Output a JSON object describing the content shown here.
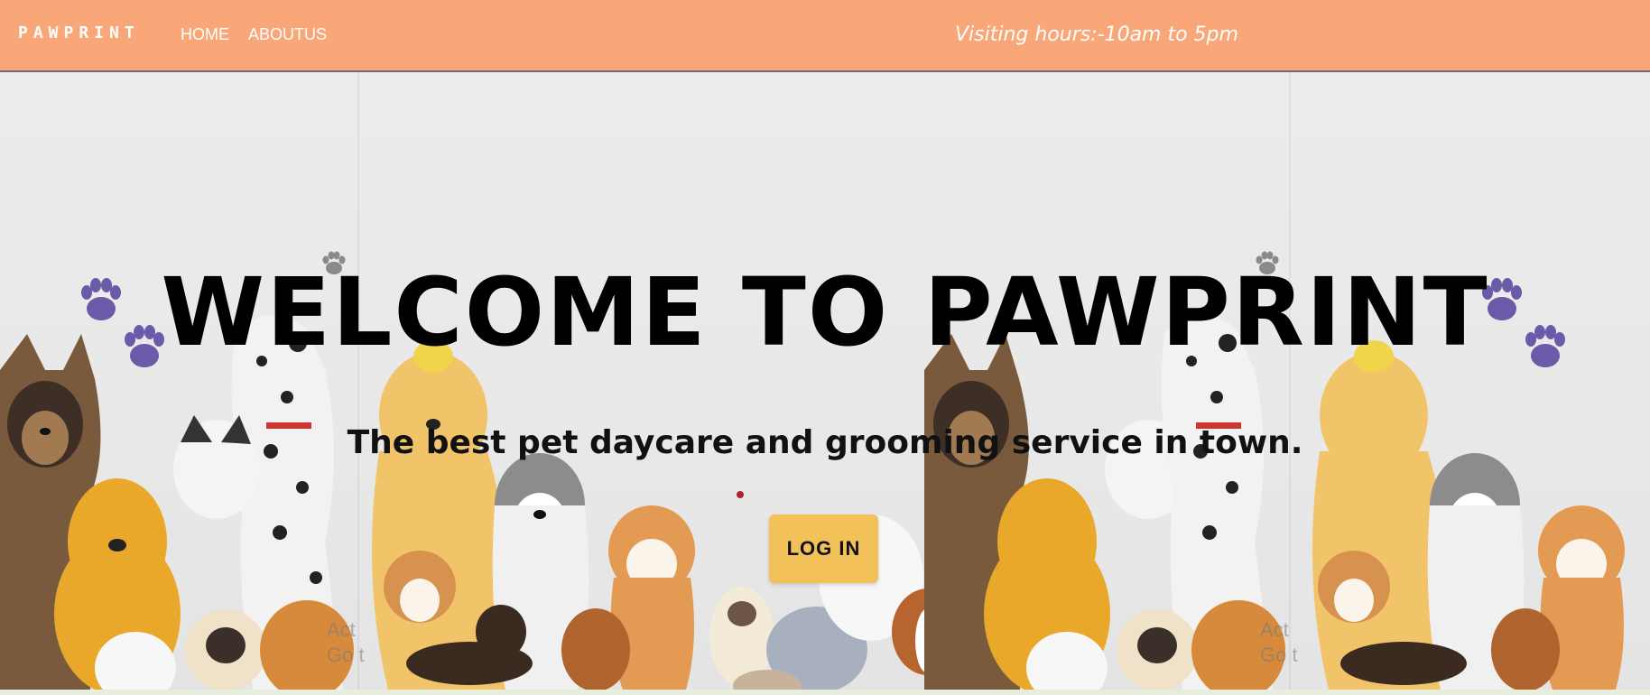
{
  "navbar": {
    "brand": "PAWPRINT",
    "links": [
      {
        "label": "HOME"
      },
      {
        "label": "ABOUTUS"
      }
    ],
    "visiting_hours": "Visiting hours:-10am to 5pm",
    "background_color": "#f9a778"
  },
  "hero": {
    "title": "WELCOME TO PAWPRINT",
    "tagline": "The best pet daycare and grooming service in town.",
    "login_label": "LOG IN",
    "login_color": "#f2c15a",
    "paw_color": "#6a5aa8",
    "watermark_line1": "Act",
    "watermark_line2": "Go t"
  }
}
